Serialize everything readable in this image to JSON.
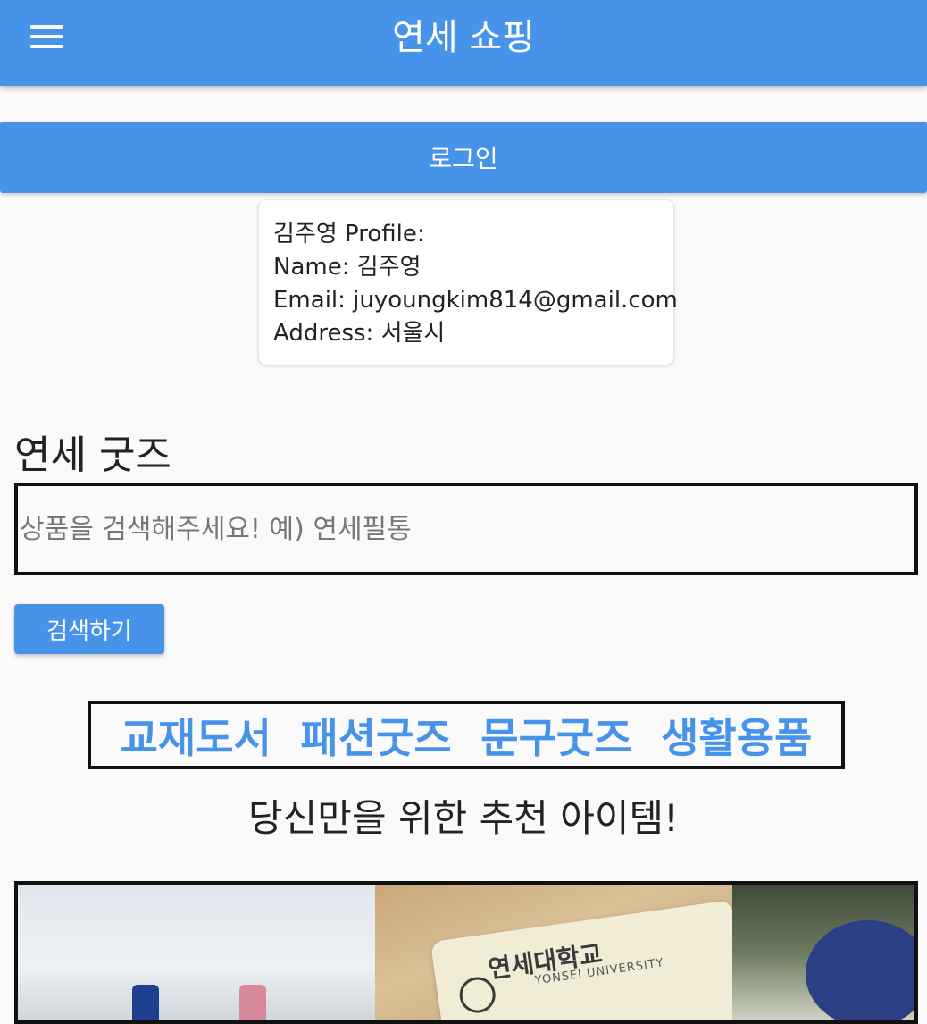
{
  "app_bar": {
    "title": "연세 쇼핑",
    "menu_icon": "hamburger-menu-icon",
    "color": "#4893ea"
  },
  "login": {
    "label": "로그인"
  },
  "profile": {
    "heading": "김주영 Profile:",
    "name_line": "Name: 김주영",
    "email_line": "Email: juyoungkim814@gmail.com",
    "address_line": "Address: 서울시"
  },
  "goods": {
    "title": "연세 굿즈",
    "search_placeholder": "상품을 검색해주세요! 예) 연세필통",
    "search_value": "",
    "search_button": "검색하기"
  },
  "categories": [
    "교재도서",
    "패션굿즈",
    "문구굿즈",
    "생활용품"
  ],
  "recommend": {
    "title": "당신만을 위한 추천 아이템!"
  },
  "carousel": {
    "pouch_text": "연세대학교",
    "pouch_subtext": "YONSEI UNIVERSITY"
  }
}
